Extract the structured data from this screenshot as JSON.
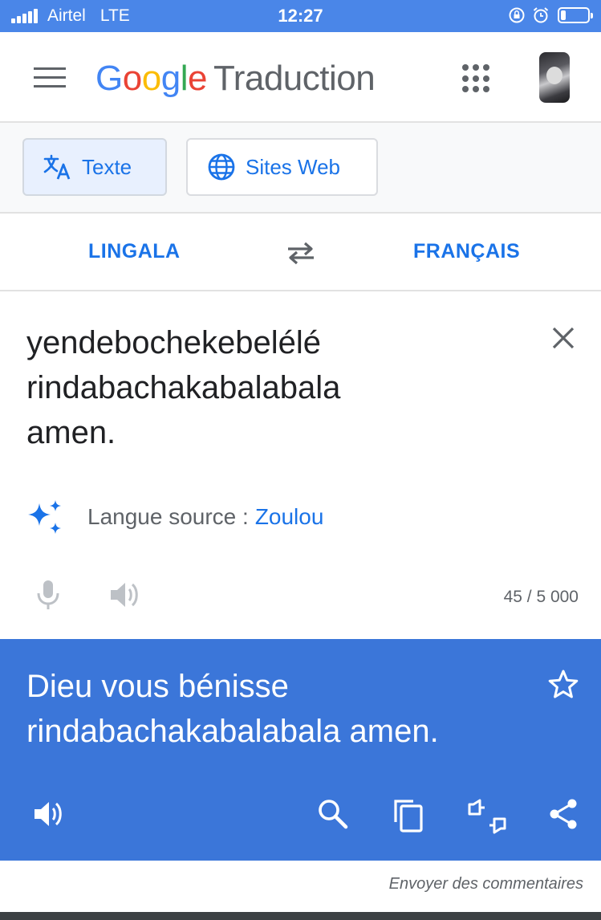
{
  "status_bar": {
    "carrier": "Airtel",
    "network": "LTE",
    "time": "12:27",
    "battery_level": 0.2,
    "icons": [
      "signal-icon",
      "orientation-lock-icon",
      "alarm-icon",
      "battery-icon"
    ]
  },
  "header": {
    "logo_letters": [
      "G",
      "o",
      "o",
      "g",
      "l",
      "e"
    ],
    "product": "Traduction",
    "icons": [
      "menu-icon",
      "apps-icon",
      "avatar"
    ]
  },
  "modes": {
    "text_label": "Texte",
    "web_label": "Sites Web",
    "active": "text"
  },
  "languages": {
    "source": "LINGALA",
    "target": "FRANÇAIS"
  },
  "source": {
    "lines": [
      "yendebochekebelélé",
      "rindabachakabalabala",
      "amen."
    ],
    "detect_label": "Langue source :",
    "detect_lang": "Zoulou",
    "char_count": "45 / 5 000"
  },
  "result": {
    "lines": [
      "Dieu vous bénisse",
      "rindabachakabalabala amen."
    ],
    "actions": [
      "speaker-icon",
      "search-icon",
      "copy-icon",
      "feedback-icon",
      "share-icon"
    ]
  },
  "footer": {
    "feedback_label": "Envoyer des commentaires"
  },
  "colors": {
    "status_bar": "#4a86e8",
    "accent": "#1a73e8",
    "result_bg": "#3b76d9"
  }
}
